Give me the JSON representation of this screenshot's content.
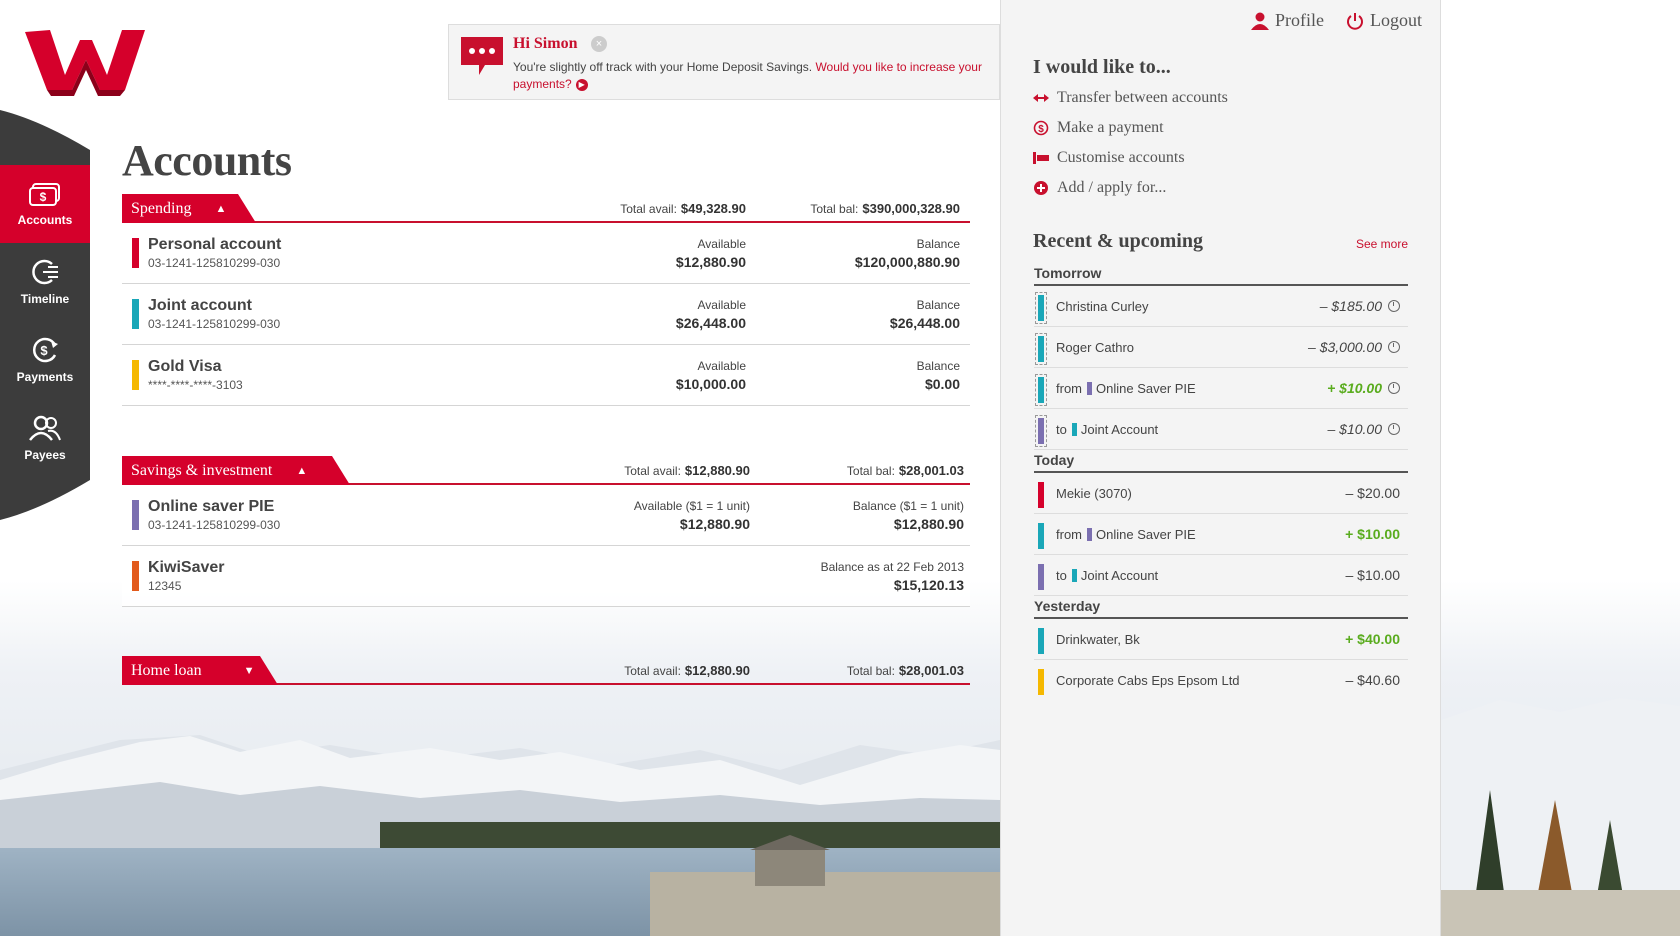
{
  "colors": {
    "brand_red": "#d5002b",
    "nav_dark": "#3c3c3c",
    "account_red": "#d5002b",
    "account_teal": "#1aa7b8",
    "account_yellow": "#f5b800",
    "account_purple": "#7b6fb0",
    "account_orange": "#e25a1c",
    "positive_green": "#5aac1e"
  },
  "nav": {
    "items": [
      {
        "label": "Accounts",
        "icon": "money-icon"
      },
      {
        "label": "Timeline",
        "icon": "timeline-icon"
      },
      {
        "label": "Payments",
        "icon": "payments-icon"
      },
      {
        "label": "Payees",
        "icon": "payees-icon"
      }
    ]
  },
  "notice": {
    "title": "Hi Simon",
    "text": "You're slightly off track with your Home Deposit Savings. ",
    "link": "Would you like to increase your payments?"
  },
  "page": {
    "title": "Accounts"
  },
  "spending": {
    "label": "Spending",
    "avail_label": "Total avail:",
    "avail": "$49,328.90",
    "bal_label": "Total bal:",
    "bal": "$390,000,328.90",
    "accounts": [
      {
        "name": "Personal account",
        "number": "03-1241-125810299-030",
        "avail_label": "Available",
        "avail": "$12,880.90",
        "bal_label": "Balance",
        "bal": "$120,000,880.90"
      },
      {
        "name": "Joint account",
        "number": "03-1241-125810299-030",
        "avail_label": "Available",
        "avail": "$26,448.00",
        "bal_label": "Balance",
        "bal": "$26,448.00"
      },
      {
        "name": "Gold Visa",
        "number": "****-****-****-3103",
        "avail_label": "Available",
        "avail": "$10,000.00",
        "bal_label": "Balance",
        "bal": "$0.00"
      }
    ]
  },
  "savings": {
    "label": "Savings & investment",
    "avail_label": "Total avail:",
    "avail": "$12,880.90",
    "bal_label": "Total bal:",
    "bal": "$28,001.03",
    "accounts": [
      {
        "name": "Online saver PIE",
        "number": "03-1241-125810299-030",
        "avail_label": "Available ($1 = 1 unit)",
        "avail": "$12,880.90",
        "bal_label": "Balance ($1 = 1 unit)",
        "bal": "$12,880.90"
      },
      {
        "name": "KiwiSaver",
        "number": "12345",
        "bal_label": "Balance as at 22 Feb 2013",
        "bal": "$15,120.13"
      }
    ]
  },
  "homeloan": {
    "label": "Home loan",
    "avail_label": "Total avail:",
    "avail": "$12,880.90",
    "bal_label": "Total bal:",
    "bal": "$28,001.03"
  },
  "topbar": {
    "profile": "Profile",
    "logout": "Logout"
  },
  "actions": {
    "heading": "I would like to...",
    "items": [
      {
        "label": "Transfer between accounts",
        "icon": "transfer-icon"
      },
      {
        "label": "Make a payment",
        "icon": "payment-icon"
      },
      {
        "label": "Customise accounts",
        "icon": "customise-icon"
      },
      {
        "label": "Add / apply for...",
        "icon": "add-icon"
      }
    ]
  },
  "recent": {
    "heading": "Recent & upcoming",
    "see_more": "See more",
    "tomorrow": {
      "label": "Tomorrow",
      "items": [
        {
          "desc": "Christina Curley",
          "amount": "– $185.00"
        },
        {
          "desc": "Roger Cathro",
          "amount": "– $3,000.00"
        },
        {
          "prefix": "from",
          "desc": "Online Saver PIE",
          "amount": "+ $10.00"
        },
        {
          "prefix": "to",
          "desc": "Joint Account",
          "amount": "– $10.00"
        }
      ]
    },
    "today": {
      "label": "Today",
      "items": [
        {
          "desc": "Mekie (3070)",
          "amount": "– $20.00"
        },
        {
          "prefix": "from",
          "desc": "Online Saver PIE",
          "amount": "+ $10.00"
        },
        {
          "prefix": "to",
          "desc": "Joint Account",
          "amount": "– $10.00"
        }
      ]
    },
    "yesterday": {
      "label": "Yesterday",
      "items": [
        {
          "desc": "Drinkwater, Bk",
          "amount": "+ $40.00"
        },
        {
          "desc": "Corporate Cabs Eps Epsom Ltd",
          "amount": "– $40.60"
        }
      ]
    }
  }
}
